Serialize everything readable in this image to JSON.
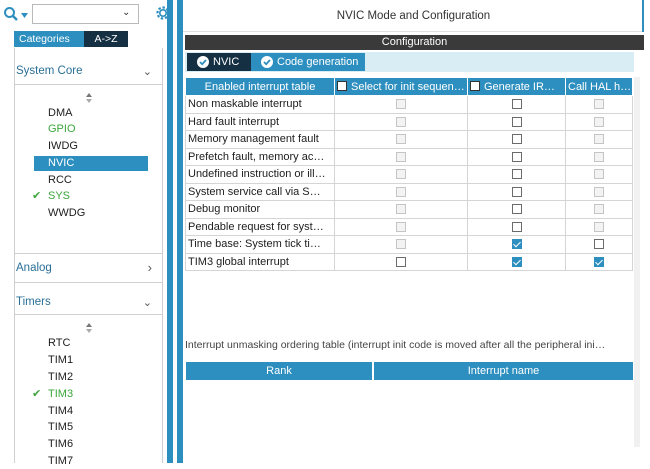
{
  "left_panel": {
    "search": {
      "value": "",
      "placeholder": ""
    },
    "tabs": [
      {
        "label": "Categories"
      },
      {
        "label": "A->Z"
      }
    ],
    "system_core": {
      "label": "System Core",
      "items": [
        {
          "label": "DMA",
          "state": "normal"
        },
        {
          "label": "GPIO",
          "state": "green"
        },
        {
          "label": "IWDG",
          "state": "normal"
        },
        {
          "label": "NVIC",
          "state": "selected"
        },
        {
          "label": "RCC",
          "state": "normal"
        },
        {
          "label": "SYS",
          "state": "checked"
        },
        {
          "label": "WWDG",
          "state": "normal"
        }
      ]
    },
    "analog": {
      "label": "Analog"
    },
    "timers": {
      "label": "Timers",
      "items": [
        {
          "label": "RTC",
          "state": "normal"
        },
        {
          "label": "TIM1",
          "state": "normal"
        },
        {
          "label": "TIM2",
          "state": "normal"
        },
        {
          "label": "TIM3",
          "state": "checked"
        },
        {
          "label": "TIM4",
          "state": "normal"
        },
        {
          "label": "TIM5",
          "state": "normal"
        },
        {
          "label": "TIM6",
          "state": "normal"
        },
        {
          "label": "TIM7",
          "state": "normal"
        }
      ]
    }
  },
  "main": {
    "title": "NVIC Mode and Configuration",
    "configuration_label": "Configuration",
    "tabs": [
      {
        "label": "NVIC"
      },
      {
        "label": "Code generation"
      }
    ],
    "table": {
      "headers": [
        "Enabled interrupt table",
        "Select for init sequen…",
        "Generate IR…",
        "Call HAL h…"
      ],
      "rows": [
        {
          "name": "Non maskable interrupt",
          "select": "disabled",
          "generate": "unchecked",
          "call": "disabled"
        },
        {
          "name": "Hard fault interrupt",
          "select": "disabled",
          "generate": "unchecked",
          "call": "disabled"
        },
        {
          "name": "Memory management fault",
          "select": "disabled",
          "generate": "unchecked",
          "call": "disabled"
        },
        {
          "name": "Prefetch fault, memory ac…",
          "select": "disabled",
          "generate": "unchecked",
          "call": "disabled"
        },
        {
          "name": "Undefined instruction or ill…",
          "select": "disabled",
          "generate": "unchecked",
          "call": "disabled"
        },
        {
          "name": "System service call via S…",
          "select": "disabled",
          "generate": "unchecked",
          "call": "disabled"
        },
        {
          "name": "Debug monitor",
          "select": "disabled",
          "generate": "unchecked",
          "call": "disabled"
        },
        {
          "name": "Pendable request for syst…",
          "select": "disabled",
          "generate": "unchecked",
          "call": "disabled"
        },
        {
          "name": "Time base: System tick ti…",
          "select": "disabled",
          "generate": "checked",
          "call": "unchecked"
        },
        {
          "name": "TIM3 global interrupt",
          "select": "unchecked",
          "generate": "checked",
          "call": "checked"
        }
      ]
    },
    "ordering_note": "Interrupt unmasking ordering table (interrupt init code is moved after all the peripheral ini…",
    "ordering_headers": [
      "Rank",
      "Interrupt name"
    ]
  },
  "colors": {
    "accent": "#2d8fbf",
    "dark_tab": "#153043",
    "green": "#3ba63b",
    "config_bar": "#3a3a3a"
  },
  "icons": {
    "search": "search-icon",
    "gear": "gear-icon",
    "chevron": "chevron-down-icon",
    "check": "check-icon"
  }
}
